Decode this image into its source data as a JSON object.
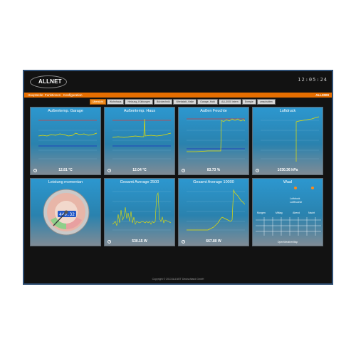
{
  "header": {
    "brand": "ALLNET",
    "clock": "12:05:24"
  },
  "menu": {
    "items": [
      "Hauptseite",
      "Funktionen",
      "Konfiguration"
    ],
    "right_label": "ALL3000"
  },
  "tabs": {
    "items": [
      "Ubersicht",
      "Wohnhaus",
      "Heizung_Kühlungen",
      "Bürotechnik",
      "Werkstatt_Halle",
      "Garage_Hobi",
      "ALL3000 intern",
      "Energie",
      "umschalten"
    ],
    "active_index": 0
  },
  "tiles": [
    {
      "title": "Außentemp. Garage",
      "value": "12.81 °C"
    },
    {
      "title": "Außentemp. Haus",
      "value": "12.04 °C"
    },
    {
      "title": "Außen Feuchte",
      "value": "83.73 %"
    },
    {
      "title": "Luftdruck",
      "value": "1030.36 hPa"
    },
    {
      "title": "Leistung momentan",
      "value": ""
    },
    {
      "title": "Gesamt Average 2500",
      "value": "530.15 W"
    },
    {
      "title": "Gesamt Average 10000",
      "value": "667.80 W"
    },
    {
      "title": "Waal",
      "value": ""
    }
  ],
  "gauge": {
    "display": "440.32",
    "level_fraction": 0.35
  },
  "weather": {
    "legend": [
      "Luftdruck",
      "Luftfeuchte"
    ],
    "columns": [
      "Morgen",
      "Mittag",
      "Abend",
      "Nacht"
    ],
    "footer": "OpenWeatherMap"
  },
  "colors": {
    "accent": "#e66e00",
    "tile_top": "#2c97cf",
    "tile_bottom": "#7f8b95",
    "line": "#e8e000"
  },
  "footer": {
    "copyright": "Copyright © 2013 ALLNET Deutschland GmbH"
  }
}
